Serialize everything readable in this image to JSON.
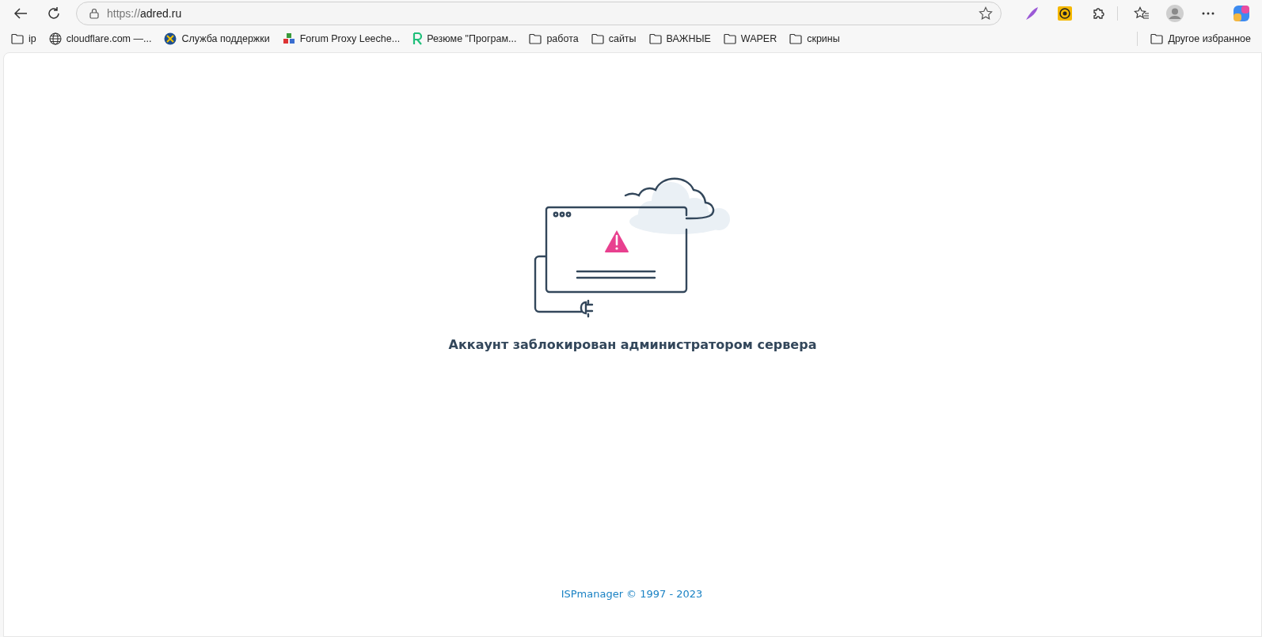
{
  "address_bar": {
    "scheme": "https://",
    "host": "adred.ru"
  },
  "bookmarks": [
    {
      "kind": "folder",
      "label": "ip"
    },
    {
      "kind": "globe",
      "label": "cloudflare.com —..."
    },
    {
      "kind": "badge",
      "label": "Служба поддержки"
    },
    {
      "kind": "cubes",
      "label": "Forum Proxy Leeche..."
    },
    {
      "kind": "letter",
      "label": "Резюме \"Програм..."
    },
    {
      "kind": "folder",
      "label": "работа"
    },
    {
      "kind": "folder",
      "label": "сайты"
    },
    {
      "kind": "folder",
      "label": "ВАЖНЫЕ"
    },
    {
      "kind": "folder",
      "label": "WAPER"
    },
    {
      "kind": "folder",
      "label": "скрины"
    }
  ],
  "other_bookmarks": {
    "label": "Другое избранное"
  },
  "page": {
    "message": "Аккаунт заблокирован администратором сервера",
    "footer": "ISPmanager © 1997 - 2023"
  }
}
